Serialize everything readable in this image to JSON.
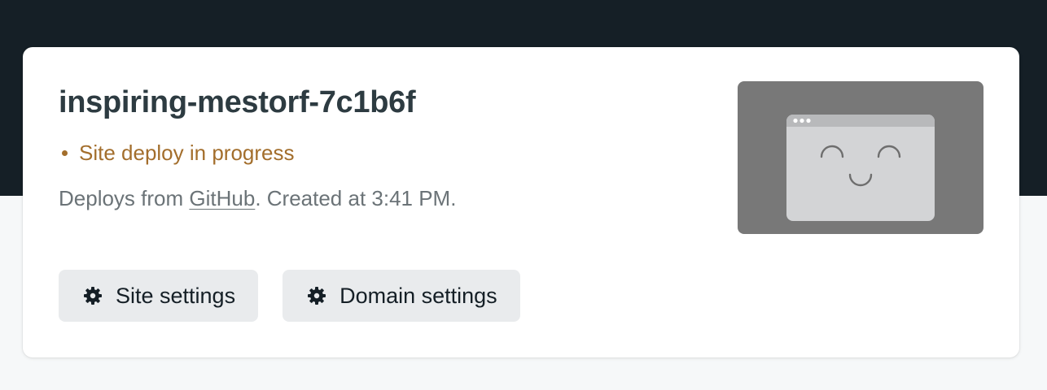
{
  "site": {
    "name": "inspiring-mestorf-7c1b6f",
    "status_text": "Site deploy in progress",
    "status_color": "#a36e2c",
    "meta_prefix": "Deploys from ",
    "meta_link": "GitHub",
    "meta_suffix": ". Created at 3:41 PM."
  },
  "actions": {
    "site_settings_label": "Site settings",
    "domain_settings_label": "Domain settings",
    "icon": "gear-icon"
  },
  "thumbnail": {
    "icon": "smiling-browser-window-icon",
    "background": "#787878"
  }
}
